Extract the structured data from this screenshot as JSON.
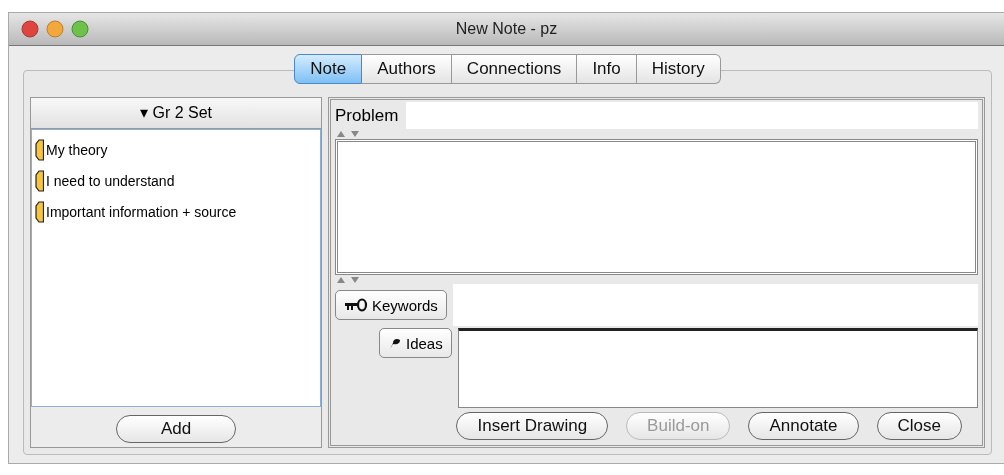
{
  "window": {
    "title": "New Note - pz"
  },
  "tabs": [
    {
      "label": "Note",
      "selected": true
    },
    {
      "label": "Authors",
      "selected": false
    },
    {
      "label": "Connections",
      "selected": false
    },
    {
      "label": "Info",
      "selected": false
    },
    {
      "label": "History",
      "selected": false
    }
  ],
  "scaffold_panel": {
    "set_name": "▾ Gr 2 Set",
    "items": [
      {
        "label": "My theory"
      },
      {
        "label": "I need to understand"
      },
      {
        "label": "Important information + source"
      }
    ],
    "add_button": "Add"
  },
  "editor": {
    "problem_label": "Problem",
    "keywords_button": "Keywords",
    "ideas_button": "Ideas"
  },
  "buttons": [
    {
      "label": "Insert Drawing",
      "disabled": false
    },
    {
      "label": "Build-on",
      "disabled": true
    },
    {
      "label": "Annotate",
      "disabled": false
    },
    {
      "label": "Close",
      "disabled": false
    }
  ]
}
